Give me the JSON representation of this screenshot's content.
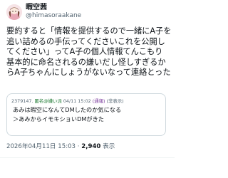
{
  "author": {
    "display_name": "暇空茜",
    "handle": "@himasoraakane"
  },
  "tweet": {
    "paragraphs": [
      "要約すると「情報を提供するので一緒にA子を追い詰めるの手伝ってくださいこれを公開してください」ってA子の個人情報てんこもり",
      "基本的に命名されるの嫌いだし怪しすぎるからA子ちゃんにしょうがないなって連絡とった"
    ]
  },
  "quote": {
    "number": "2379147.",
    "name": "匿名@嫌い派",
    "date": "04/11 15:02",
    "id": "(通報)",
    "extra": "(非表示)",
    "lines": [
      "あみは暇空になんてDMしたのか気になる",
      "＞あみからイモキショいDMがきた"
    ]
  },
  "meta": {
    "timestamp": "2026年04月11日 15:03 · ",
    "views_count": "2,940",
    "views_label": " 表示"
  },
  "colors": {
    "text": "#0f1419",
    "secondary": "#536471",
    "border": "#cfd9de"
  },
  "icons": {
    "avatar": "user-avatar-icon"
  }
}
